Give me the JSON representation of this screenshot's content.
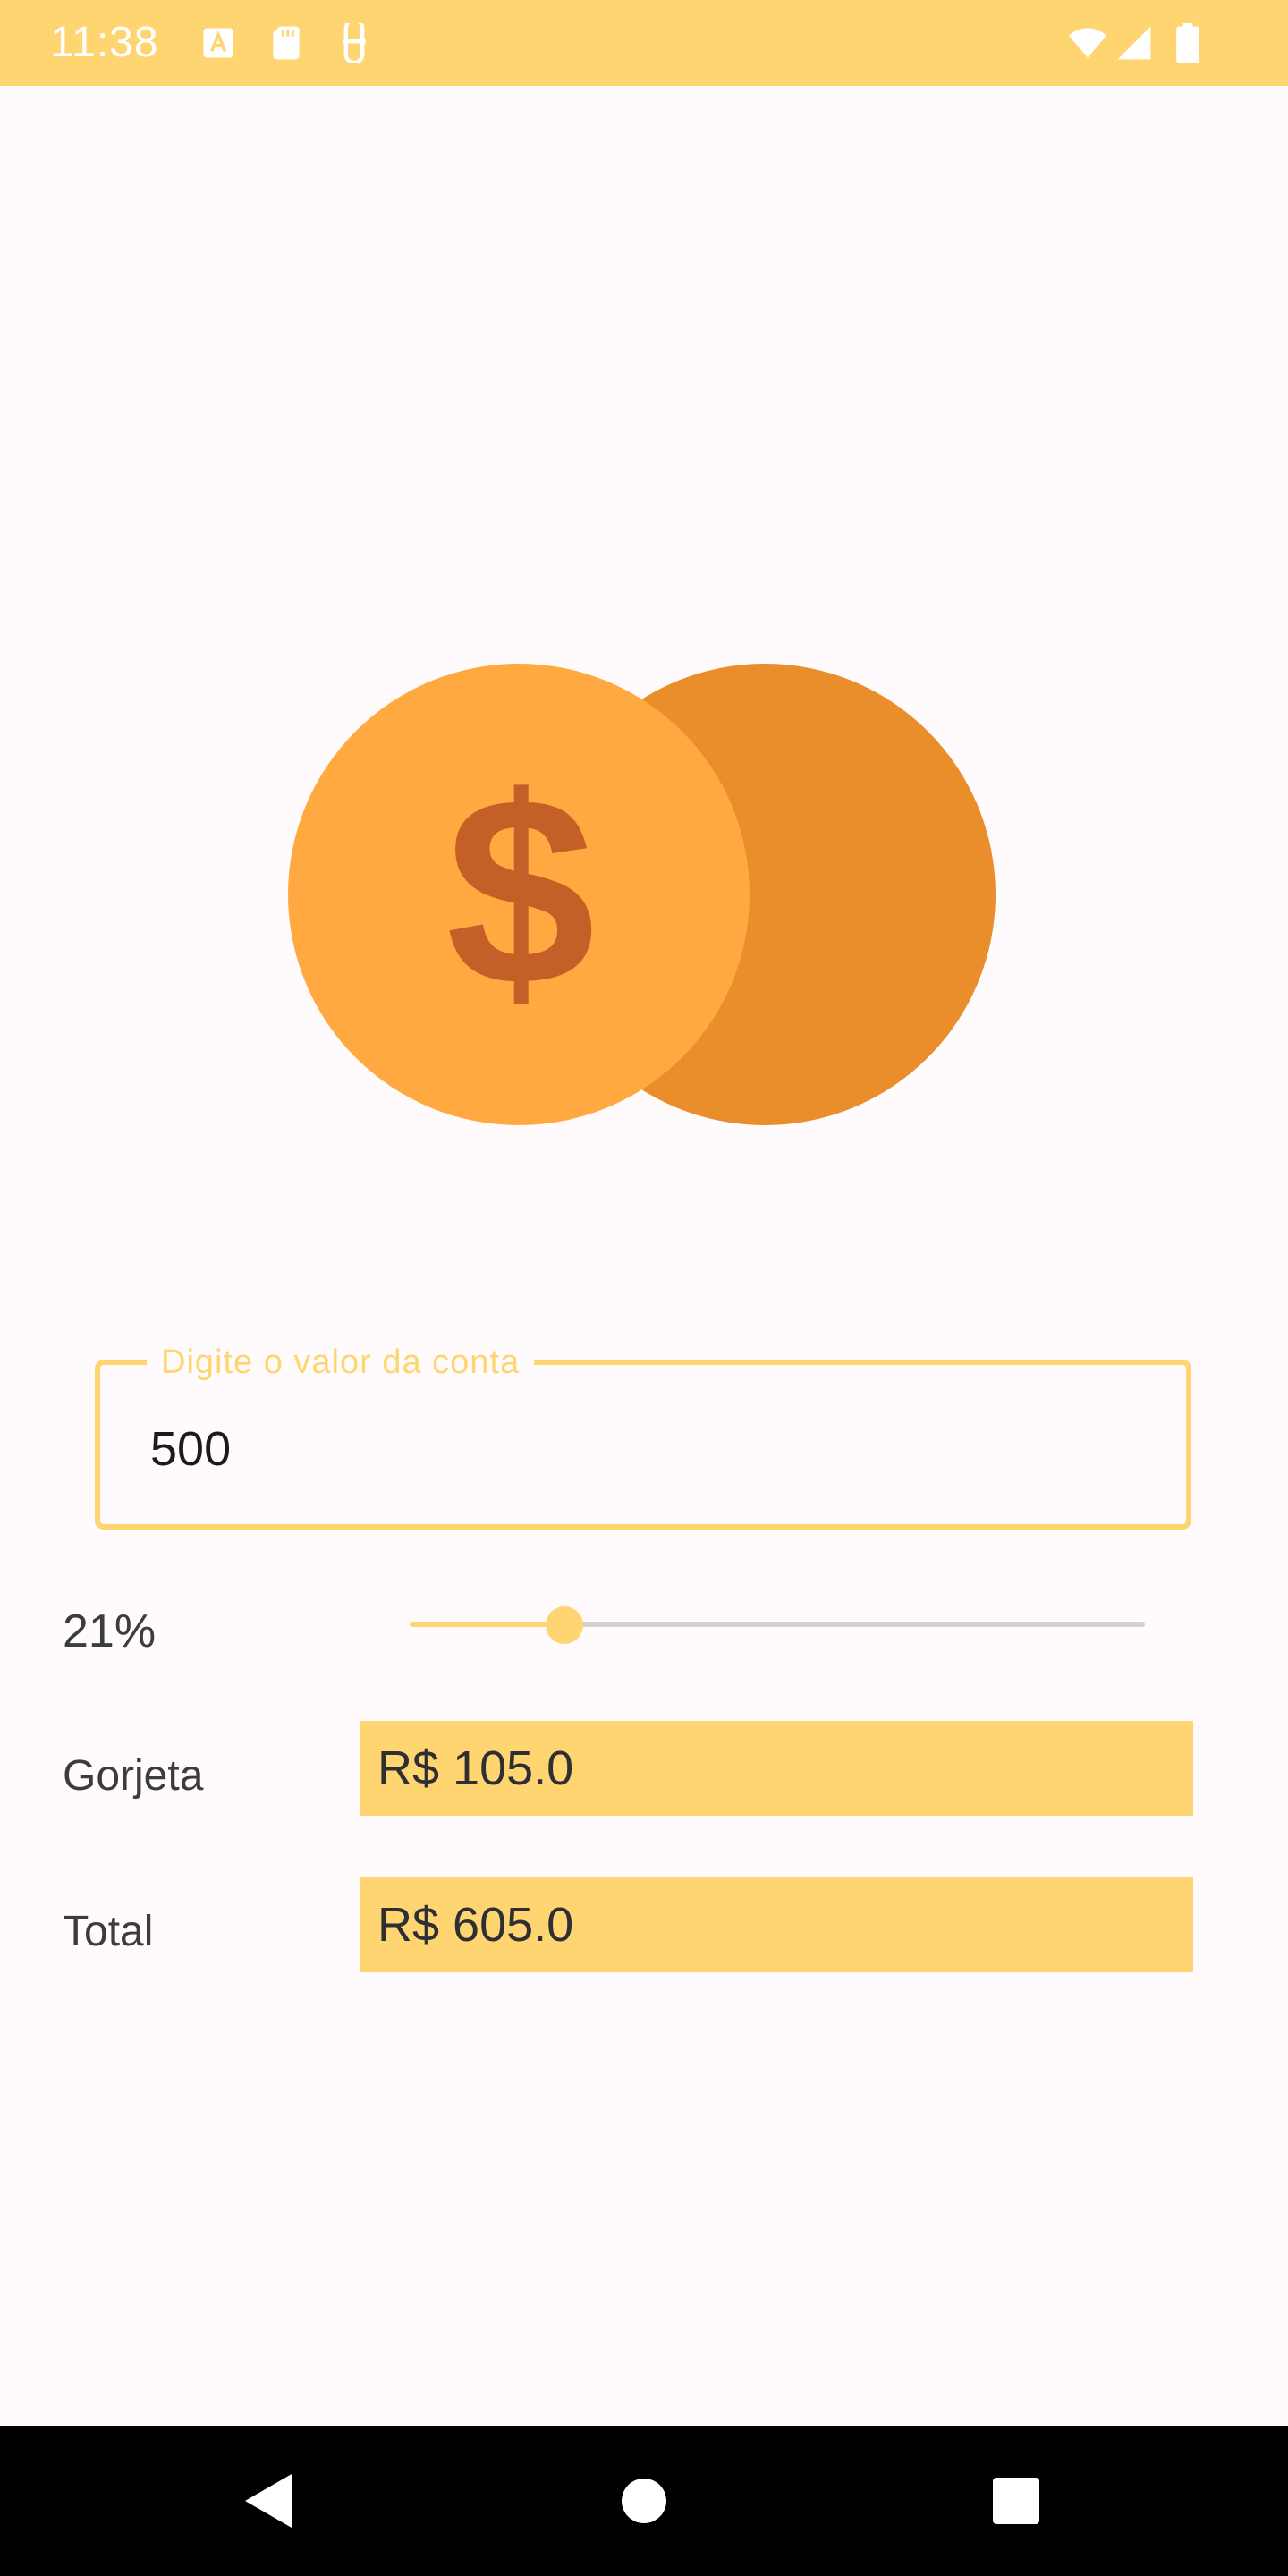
{
  "status_bar": {
    "time": "11:38",
    "icons_left": [
      "font-a-icon",
      "sd-card-icon",
      "face-mask-icon"
    ],
    "icons_right": [
      "wifi-icon",
      "cell-signal-icon",
      "battery-icon"
    ],
    "background_color": "#ffd572"
  },
  "logo": {
    "icon": "coins-dollar-icon",
    "front_coin_color": "#ffa940",
    "back_coin_color": "#ea8d2b",
    "symbol_color": "#c45f27"
  },
  "bill_input": {
    "label": "Digite o valor da conta",
    "value": "500",
    "accent_color": "#ffd572"
  },
  "tip_slider": {
    "percent_label": "21%",
    "value_fraction": 0.21
  },
  "results": {
    "tip": {
      "label": "Gorjeta",
      "value": "R$ 105.0"
    },
    "total": {
      "label": "Total",
      "value": "R$ 605.0"
    }
  },
  "nav_bar": {
    "buttons": [
      "back-icon",
      "home-icon",
      "recents-icon"
    ]
  }
}
